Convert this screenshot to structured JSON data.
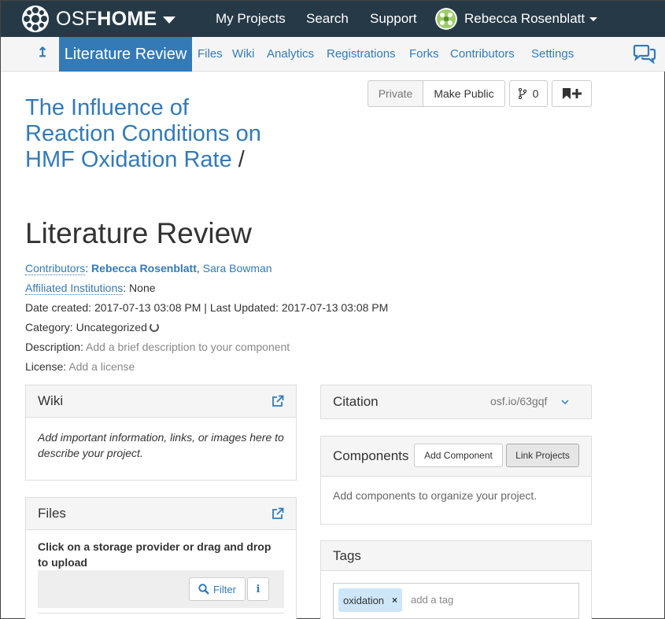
{
  "navbar": {
    "brand_osf": "OSF",
    "brand_home": "HOME",
    "links": [
      "My Projects",
      "Search",
      "Support"
    ],
    "user_name": "Rebecca Rosenblatt"
  },
  "project_nav": {
    "up_icon": "up-arrow-icon",
    "active_label": "Literature Review",
    "links": [
      "Files",
      "Wiki",
      "Analytics",
      "Registrations",
      "Forks",
      "Contributors",
      "Settings"
    ],
    "chat_icon": "comments-icon"
  },
  "header_buttons": {
    "private": "Private",
    "make_public": "Make Public",
    "fork_count": "0",
    "fork_icon": "fork-icon",
    "bookmark_icon": "bookmark-plus-icon"
  },
  "parent_title": "The Influence of Reaction Conditions on HMF Oxidation Rate",
  "parent_separator": "/",
  "page_title": "Literature Review",
  "meta": {
    "contributors_label": "Contributors",
    "contributors": [
      "Rebecca Rosenblatt",
      "Sara Bowman"
    ],
    "institutions_label": "Affiliated Institutions",
    "institutions_value": "None",
    "date_created_label": "Date created:",
    "date_created": "2017-07-13 03:08 PM",
    "last_updated_label": "Last Updated:",
    "last_updated": "2017-07-13 03:08 PM",
    "category_label": "Category:",
    "category_value": "Uncategorized",
    "description_label": "Description:",
    "description_placeholder": "Add a brief description to your component",
    "license_label": "License:",
    "license_placeholder": "Add a license"
  },
  "wiki_panel": {
    "title": "Wiki",
    "body": "Add important information, links, or images here to describe your project."
  },
  "files_panel": {
    "title": "Files",
    "body": "Click on a storage provider or drag and drop to upload",
    "filter_label": "Filter",
    "info_label": "i"
  },
  "citation_panel": {
    "title": "Citation",
    "url": "osf.io/63gqf"
  },
  "components_panel": {
    "title": "Components",
    "add_label": "Add Component",
    "link_label": "Link Projects",
    "body": "Add components to organize your project."
  },
  "tags_panel": {
    "title": "Tags",
    "tags": [
      "oxidation"
    ],
    "placeholder": "add a tag"
  },
  "colors": {
    "navbar": "#263947",
    "link": "#337ab7",
    "active_tab": "#337ab7",
    "tag": "#cde6f8"
  }
}
